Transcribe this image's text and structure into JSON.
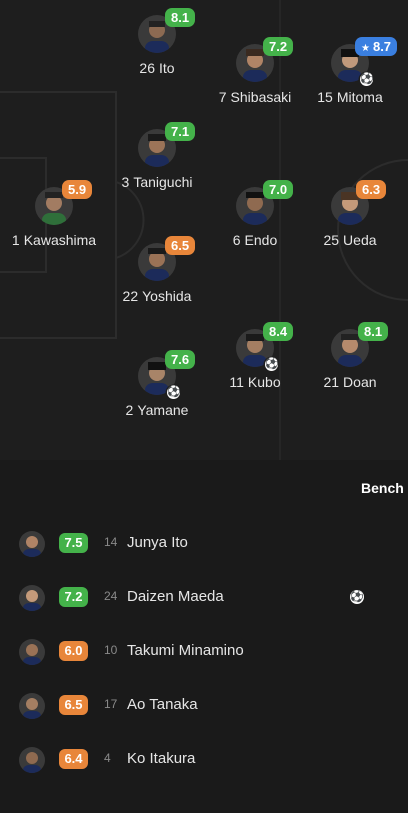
{
  "lineup": [
    {
      "number": "26",
      "name": "Ito",
      "rating": "8.1",
      "rating_color": "#44b24a",
      "badge": ""
    },
    {
      "number": "7",
      "name": "Shibasaki",
      "rating": "7.2",
      "rating_color": "#44b24a",
      "badge": ""
    },
    {
      "number": "15",
      "name": "Mitoma",
      "rating": "8.7",
      "rating_color": "#3a7fe0",
      "badge": "★",
      "goal": true
    },
    {
      "number": "3",
      "name": "Taniguchi",
      "rating": "7.1",
      "rating_color": "#44b24a",
      "badge": ""
    },
    {
      "number": "1",
      "name": "Kawashima",
      "rating": "5.9",
      "rating_color": "#e8863a",
      "badge": ""
    },
    {
      "number": "6",
      "name": "Endo",
      "rating": "7.0",
      "rating_color": "#44b24a",
      "badge": ""
    },
    {
      "number": "25",
      "name": "Ueda",
      "rating": "6.3",
      "rating_color": "#e8863a",
      "badge": ""
    },
    {
      "number": "22",
      "name": "Yoshida",
      "rating": "6.5",
      "rating_color": "#e8863a",
      "badge": ""
    },
    {
      "number": "11",
      "name": "Kubo",
      "rating": "8.4",
      "rating_color": "#44b24a",
      "badge": "",
      "goal": true
    },
    {
      "number": "21",
      "name": "Doan",
      "rating": "8.1",
      "rating_color": "#44b24a",
      "badge": ""
    },
    {
      "number": "2",
      "name": "Yamane",
      "rating": "7.6",
      "rating_color": "#44b24a",
      "badge": "",
      "goal": true
    }
  ],
  "bench": {
    "title": "Bench",
    "players": [
      {
        "number": "14",
        "name": "Junya Ito",
        "rating": "7.5",
        "rating_color": "#44b24a"
      },
      {
        "number": "24",
        "name": "Daizen Maeda",
        "rating": "7.2",
        "rating_color": "#44b24a",
        "goal": true
      },
      {
        "number": "10",
        "name": "Takumi Minamino",
        "rating": "6.0",
        "rating_color": "#e8863a"
      },
      {
        "number": "17",
        "name": "Ao Tanaka",
        "rating": "6.5",
        "rating_color": "#e8863a"
      },
      {
        "number": "4",
        "name": "Ko Itakura",
        "rating": "6.4",
        "rating_color": "#e8863a"
      }
    ]
  },
  "icons": {
    "ball": "soccer-ball-icon",
    "star": "star-icon",
    "avatar": "player-avatar"
  }
}
